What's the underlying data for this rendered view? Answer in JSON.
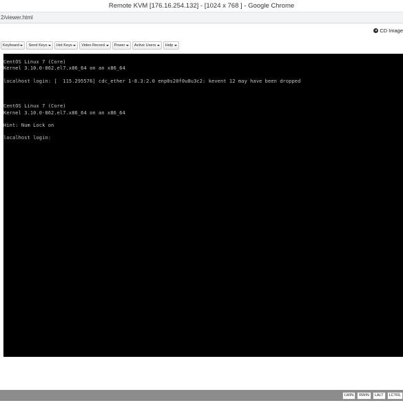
{
  "window": {
    "title": "Remote KVM [176.16.254.132] - [1024 x 768 ] - Google Chrome"
  },
  "address": {
    "url": "2/viewer.html"
  },
  "cd_image": {
    "label": "CD Image",
    "icon": "cd-icon"
  },
  "menu": {
    "items": [
      {
        "label": "Keyboard"
      },
      {
        "label": "Send Keys"
      },
      {
        "label": "Hot Keys"
      },
      {
        "label": "Video Record"
      },
      {
        "label": "Power"
      },
      {
        "label": "Active Users"
      },
      {
        "label": "Help"
      }
    ]
  },
  "console": {
    "lines": [
      "CentOS Linux 7 (Core)",
      "Kernel 3.10.0-862.el7.x86_64 on an x86_64",
      "",
      "localhost login: [  115.295576] cdc_ether 1-8.3:2.0 enp0s20f0u8u3c2: kevent 12 may have been dropped",
      "",
      "",
      "",
      "CentOS Linux 7 (Core)",
      "Kernel 3.10.0-862.el7.x86_64 on an x86_64",
      "",
      "Hint: Num Lock on",
      "",
      "localhost login:"
    ]
  },
  "status": {
    "keys": [
      {
        "label": "LWIN"
      },
      {
        "label": "RWIN"
      },
      {
        "label": "LALT"
      },
      {
        "label": "LCTRL"
      }
    ]
  },
  "colors": {
    "console_bg": "#000000",
    "console_text": "#c8c8c8",
    "statusbar_bg": "#8c8c8c"
  }
}
